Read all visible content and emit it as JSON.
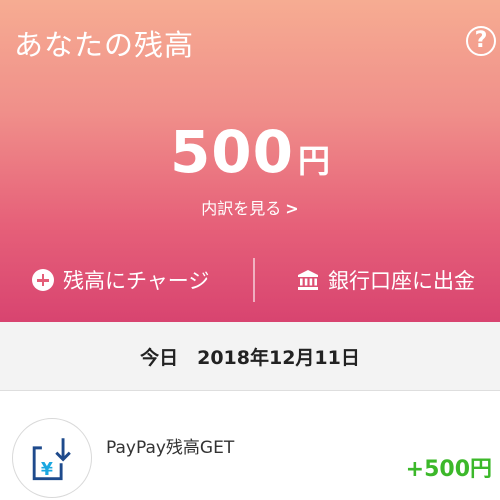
{
  "header": {
    "title": "あなたの残高",
    "help_label": "?"
  },
  "balance": {
    "amount": "500",
    "unit": "円",
    "detail_link": "内訳を見る",
    "detail_chevron": ">"
  },
  "actions": {
    "charge_label": "残高にチャージ",
    "withdraw_label": "銀行口座に出金"
  },
  "date_header": {
    "label": "今日　2018年12月11日"
  },
  "transactions": [
    {
      "title": "PayPay残高GET",
      "amount": "+500円",
      "icon": "yen-download-icon"
    }
  ],
  "colors": {
    "gradient_top": "#f6ac92",
    "gradient_bottom": "#d84470",
    "income_green": "#3cb82a",
    "icon_blue": "#1e4a8c",
    "icon_cyan": "#1aa7e0"
  }
}
